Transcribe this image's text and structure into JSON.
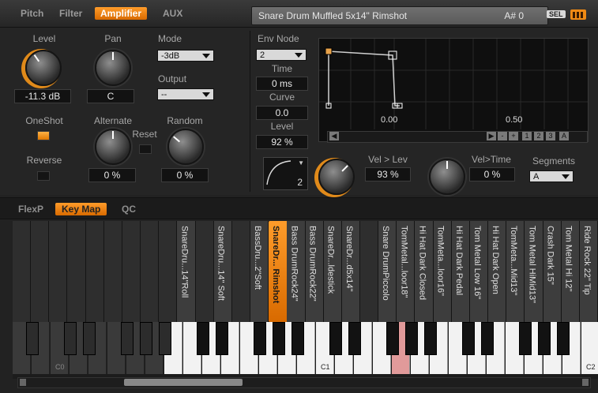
{
  "tabs": [
    "Pitch",
    "Filter",
    "Amplifier",
    "AUX"
  ],
  "preset": {
    "name": "Snare Drum Muffled 5x14\" Rimshot",
    "note": "A# 0",
    "sel": "SEL"
  },
  "amp": {
    "level_label": "Level",
    "level_value": "-11.3 dB",
    "pan_label": "Pan",
    "pan_value": "C",
    "mode_label": "Mode",
    "mode_value": "-3dB",
    "output_label": "Output",
    "output_value": "--",
    "oneshot_label": "OneShot",
    "reverse_label": "Reverse",
    "alternate_label": "Alternate",
    "alternate_value": "0 %",
    "reset_label": "Reset",
    "random_label": "Random",
    "random_value": "0 %"
  },
  "env": {
    "node_label": "Env Node",
    "node_value": "2",
    "time_label": "Time",
    "time_value": "0 ms",
    "curve_label": "Curve",
    "curve_value": "0.0",
    "level_label": "Level",
    "level_value": "92 %",
    "axis_left": "0.00",
    "axis_right": "0.50",
    "curve_num": "2",
    "vel_lev_label": "Vel > Lev",
    "vel_lev_value": "93 %",
    "vel_time_label": "Vel>Time",
    "vel_time_value": "0 %",
    "segments_label": "Segments",
    "segments_value": "A",
    "scroll_buttons": [
      "-",
      "+",
      "1",
      "2",
      "3",
      "A"
    ]
  },
  "bottom_tabs": [
    "FlexP",
    "Key Map",
    "QC"
  ],
  "slots": [
    "",
    "",
    "",
    "",
    "",
    "",
    "",
    "",
    "",
    "SnareDru...14\"Roll",
    "",
    "SnareDru...14\" Soft",
    "",
    "BassDru...2\"Soft",
    "SnareDr... Rimshot",
    "Bass DrumRock24\"",
    "Bass DrumRock22\"",
    "SnareDr...ldestick",
    "SnareDr...d5x14\"",
    "",
    "Snare DrumPiccolo",
    "TomMetal...loor18\"",
    "Hi Hat Dark Closed",
    "TomMeta...loor16\"",
    "Hi Hat Dark Pedal",
    "Tom Metal Low 16\"",
    "Hi Hat Dark Open",
    "TomMeta...Mid13\"",
    "Tom Metal HiMid13\"",
    "Crash Dark 15\"",
    "Tom Metal Hi 12\"",
    "Ride Rock 22\" Tip"
  ],
  "octaves": [
    "C0",
    "C1",
    "C2"
  ],
  "colors": {
    "accent": "#f08a14",
    "hit_key": "#e19a9a"
  }
}
